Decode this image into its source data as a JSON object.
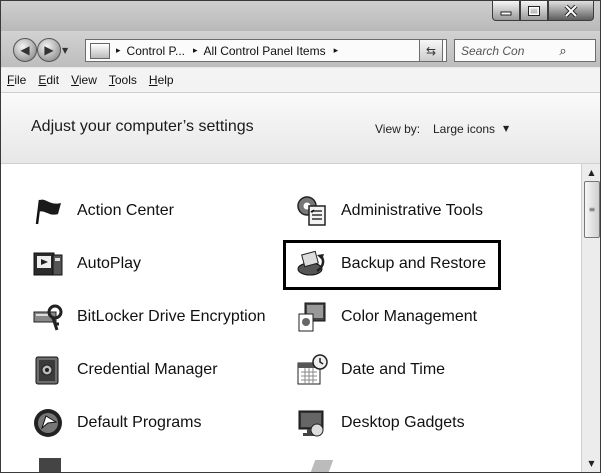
{
  "titlebar": {
    "buttons": [
      "minimize",
      "maximize",
      "close"
    ]
  },
  "nav": {
    "back_icon": "back-arrow-icon",
    "forward_icon": "forward-arrow-icon",
    "address": {
      "crumbs": [
        "Control P...",
        "All Control Panel Items"
      ],
      "separator": "▸"
    },
    "search": {
      "placeholder": "Search Control Pa..."
    }
  },
  "menubar": {
    "items": [
      "File",
      "Edit",
      "View",
      "Tools",
      "Help"
    ]
  },
  "header": {
    "title": "Adjust your computer’s settings",
    "view_by_label": "View by:",
    "view_by_value": "Large icons"
  },
  "items": [
    {
      "label": "Action Center",
      "icon": "flag-icon"
    },
    {
      "label": "Administrative Tools",
      "icon": "admin-tools-icon"
    },
    {
      "label": "AutoPlay",
      "icon": "autoplay-icon"
    },
    {
      "label": "Backup and Restore",
      "icon": "backup-icon",
      "highlighted": true
    },
    {
      "label": "BitLocker Drive Encryption",
      "icon": "bitlocker-icon"
    },
    {
      "label": "Color Management",
      "icon": "color-management-icon"
    },
    {
      "label": "Credential Manager",
      "icon": "credential-icon"
    },
    {
      "label": "Date and Time",
      "icon": "calendar-clock-icon"
    },
    {
      "label": "Default Programs",
      "icon": "default-programs-icon"
    },
    {
      "label": "Desktop Gadgets",
      "icon": "gadgets-icon"
    }
  ]
}
